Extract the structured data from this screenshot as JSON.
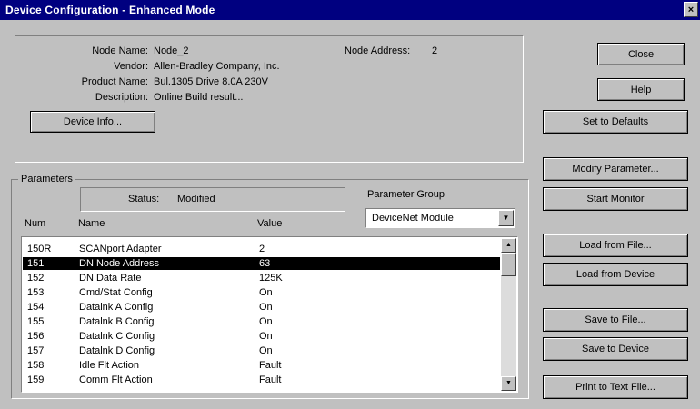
{
  "title": "Device Configuration - Enhanced Mode",
  "window_close_glyph": "×",
  "device": {
    "node_name_label": "Node Name:",
    "node_name": "Node_2",
    "node_address_label": "Node Address:",
    "node_address": "2",
    "vendor_label": "Vendor:",
    "vendor": "Allen-Bradley Company, Inc.",
    "product_label": "Product Name:",
    "product": "Bul.1305 Drive  8.0A  230V",
    "description_label": "Description:",
    "description": "Online Build result...",
    "info_button": "Device Info..."
  },
  "parameters": {
    "group_label": "Parameters",
    "status_label": "Status:",
    "status_value": "Modified",
    "param_group_label": "Parameter Group",
    "param_group_value": "DeviceNet Module",
    "columns": {
      "num": "Num",
      "name": "Name",
      "value": "Value"
    },
    "rows": [
      {
        "num": "150R",
        "name": "SCANport Adapter",
        "value": "2"
      },
      {
        "num": "151",
        "name": "DN Node Address",
        "value": "63"
      },
      {
        "num": "152",
        "name": "DN Data Rate",
        "value": "125K"
      },
      {
        "num": "153",
        "name": "Cmd/Stat Config",
        "value": "On"
      },
      {
        "num": "154",
        "name": "Datalnk A Config",
        "value": "On"
      },
      {
        "num": "155",
        "name": "Datalnk B Config",
        "value": "On"
      },
      {
        "num": "156",
        "name": "Datalnk C Config",
        "value": "On"
      },
      {
        "num": "157",
        "name": "Datalnk D Config",
        "value": "On"
      },
      {
        "num": "158",
        "name": "Idle Flt Action",
        "value": "Fault"
      },
      {
        "num": "159",
        "name": "Comm Flt Action",
        "value": "Fault"
      }
    ],
    "selected_num": "151"
  },
  "buttons": {
    "close": "Close",
    "help": "Help",
    "set_defaults": "Set to Defaults",
    "modify": "Modify Parameter...",
    "start_monitor": "Start Monitor",
    "load_file": "Load from File...",
    "load_device": "Load from Device",
    "save_file": "Save to File...",
    "save_device": "Save to Device",
    "print_text": "Print to Text File..."
  },
  "colors": {
    "title_bar": "#000080",
    "face": "#c0c0c0",
    "selection": "#000000"
  }
}
